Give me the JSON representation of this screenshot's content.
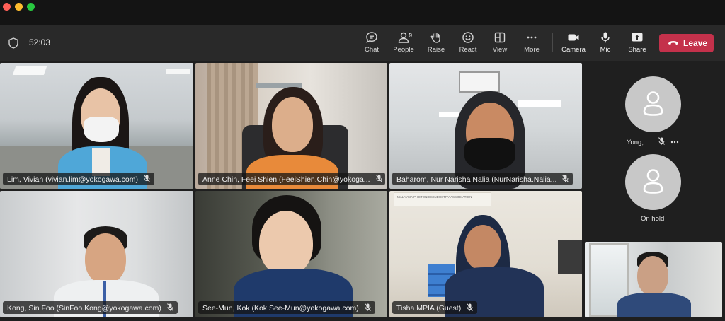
{
  "window": {
    "traffic_lights": [
      "close",
      "minimize",
      "zoom"
    ]
  },
  "toolbar": {
    "timer": "52:03",
    "chat_label": "Chat",
    "people_label": "People",
    "people_count": "9",
    "raise_label": "Raise",
    "react_label": "React",
    "view_label": "View",
    "more_label": "More",
    "camera_label": "Camera",
    "mic_label": "Mic",
    "share_label": "Share",
    "leave_label": "Leave",
    "leave_color": "#c4314b"
  },
  "participants": [
    {
      "name": "Lim, Vivian (vivian.lim@yokogawa.com)"
    },
    {
      "name": "Anne Chin, Feei Shien (FeeiShien.Chin@yokoga..."
    },
    {
      "name": "Baharom, Nur Narisha Nalia (NurNarisha.Nalia..."
    },
    {
      "name": "Kong, Sin Foo (SinFoo.Kong@yokogawa.com)"
    },
    {
      "name": "See-Mun, Kok (Kok.See-Mun@yokogawa.com)"
    },
    {
      "name": "Tisha MPIA (Guest)"
    }
  ],
  "sidebar": {
    "participant_1": {
      "name": "Yong, ..."
    },
    "participant_2": {
      "name": "On hold"
    }
  },
  "wall_sign": "MALAYSIA PHOTONICS INDUSTRY ASSOCIATION"
}
